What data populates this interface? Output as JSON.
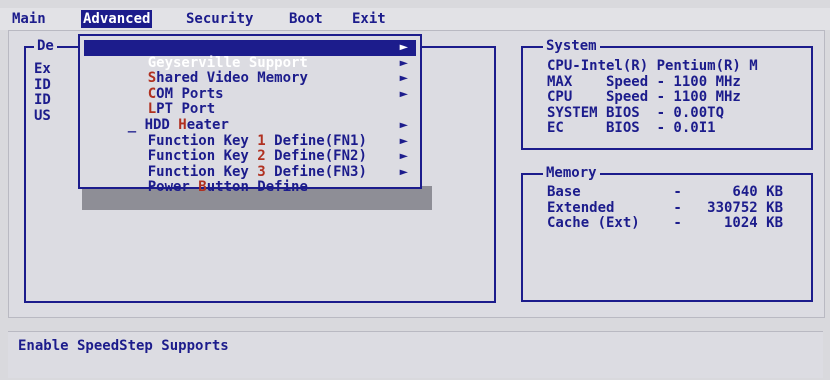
{
  "menubar": {
    "items": [
      "Main",
      "Advanced",
      "Security",
      "Boot",
      "Exit"
    ],
    "active": "Advanced"
  },
  "left_panel": {
    "title_partial": "De",
    "lines": [
      "Ex",
      "ID",
      "ID",
      "US"
    ]
  },
  "dropdown": {
    "items": [
      {
        "pre": "Geyserville Support",
        "key": "",
        "post": "",
        "arrow": "►",
        "selected": true
      },
      {
        "pre": "",
        "key": "S",
        "post": "hared Video Memory",
        "arrow": "►"
      },
      {
        "pre": "",
        "key": "C",
        "post": "OM Ports",
        "arrow": "►"
      },
      {
        "pre": "",
        "key": "L",
        "post": "PT Port",
        "arrow": "►"
      },
      {
        "pre": "_ HDD ",
        "key": "H",
        "post": "eater",
        "arrow": ""
      },
      {
        "pre": "Function Key ",
        "key": "1",
        "post": " Define(FN1)",
        "arrow": "►"
      },
      {
        "pre": "Function Key ",
        "key": "2",
        "post": " Define(FN2)",
        "arrow": "►"
      },
      {
        "pre": "Function Key ",
        "key": "3",
        "post": " Define(FN3)",
        "arrow": "►"
      },
      {
        "pre": "Power ",
        "key": "B",
        "post": "utton Define",
        "arrow": "►"
      }
    ]
  },
  "system": {
    "title": "System",
    "lines": [
      "CPU-Intel(R) Pentium(R) M",
      "MAX    Speed - 1100 MHz",
      "CPU    Speed - 1100 MHz",
      "SYSTEM BIOS  - 0.00TQ",
      "EC     BIOS  - 0.0I1"
    ]
  },
  "memory": {
    "title": "Memory",
    "lines": [
      "Base           -      640 KB",
      "Extended       -   330752 KB",
      "Cache (Ext)    -     1024 KB"
    ]
  },
  "status": {
    "text": "Enable SpeedStep Supports"
  },
  "colors": {
    "text": "#1c1c8c",
    "background": "#dcdce2",
    "hotkey": "#b03020",
    "highlight": "#1c1c8c"
  }
}
